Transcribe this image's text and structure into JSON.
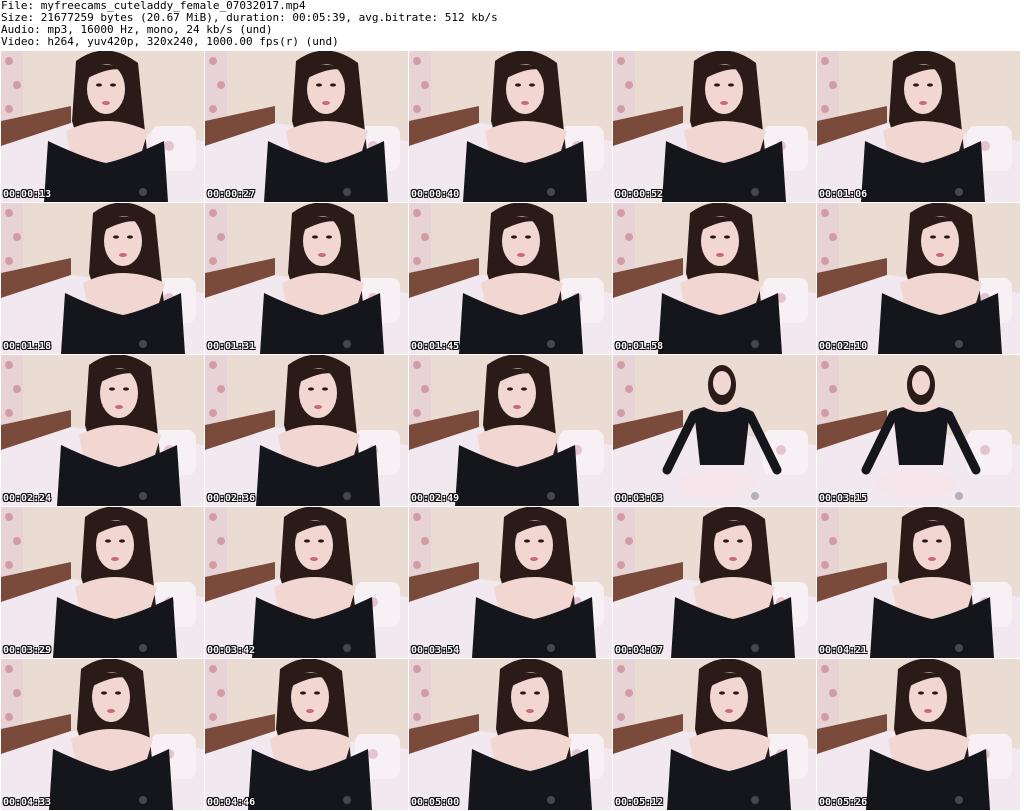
{
  "header": {
    "file_line": "File: myfreecams_cuteladdy_female_07032017.mp4",
    "size_line": "Size: 21677259 bytes (20.67 MiB), duration: 00:05:39, avg.bitrate: 512 kb/s",
    "audio_line": "Audio: mp3, 16000 Hz, mono, 24 kb/s (und)",
    "video_line": "Video: h264, yuv420p, 320x240, 1000.00 fps(r) (und)"
  },
  "colors": {
    "wall": "#eadcd2",
    "bed": "#f2e8f0",
    "headboard": "#7a4a3a",
    "outfit": "#15151c",
    "hair": "#2a1a18",
    "skin": "#f2d6d2"
  },
  "thumbnails": [
    {
      "timestamp": "00:00:13",
      "pose": "close"
    },
    {
      "timestamp": "00:00:27",
      "pose": "close"
    },
    {
      "timestamp": "00:00:40",
      "pose": "close"
    },
    {
      "timestamp": "00:00:52",
      "pose": "close"
    },
    {
      "timestamp": "00:01:06",
      "pose": "close"
    },
    {
      "timestamp": "00:01:18",
      "pose": "close"
    },
    {
      "timestamp": "00:01:31",
      "pose": "close"
    },
    {
      "timestamp": "00:01:45",
      "pose": "close"
    },
    {
      "timestamp": "00:01:58",
      "pose": "close"
    },
    {
      "timestamp": "00:02:10",
      "pose": "close"
    },
    {
      "timestamp": "00:02:24",
      "pose": "close"
    },
    {
      "timestamp": "00:02:36",
      "pose": "close"
    },
    {
      "timestamp": "00:02:49",
      "pose": "close"
    },
    {
      "timestamp": "00:03:03",
      "pose": "far"
    },
    {
      "timestamp": "00:03:15",
      "pose": "far"
    },
    {
      "timestamp": "00:03:29",
      "pose": "close"
    },
    {
      "timestamp": "00:03:42",
      "pose": "close"
    },
    {
      "timestamp": "00:03:54",
      "pose": "close"
    },
    {
      "timestamp": "00:04:07",
      "pose": "close"
    },
    {
      "timestamp": "00:04:21",
      "pose": "close"
    },
    {
      "timestamp": "00:04:33",
      "pose": "close"
    },
    {
      "timestamp": "00:04:46",
      "pose": "close"
    },
    {
      "timestamp": "00:05:00",
      "pose": "close"
    },
    {
      "timestamp": "00:05:12",
      "pose": "close"
    },
    {
      "timestamp": "00:05:26",
      "pose": "close"
    }
  ]
}
